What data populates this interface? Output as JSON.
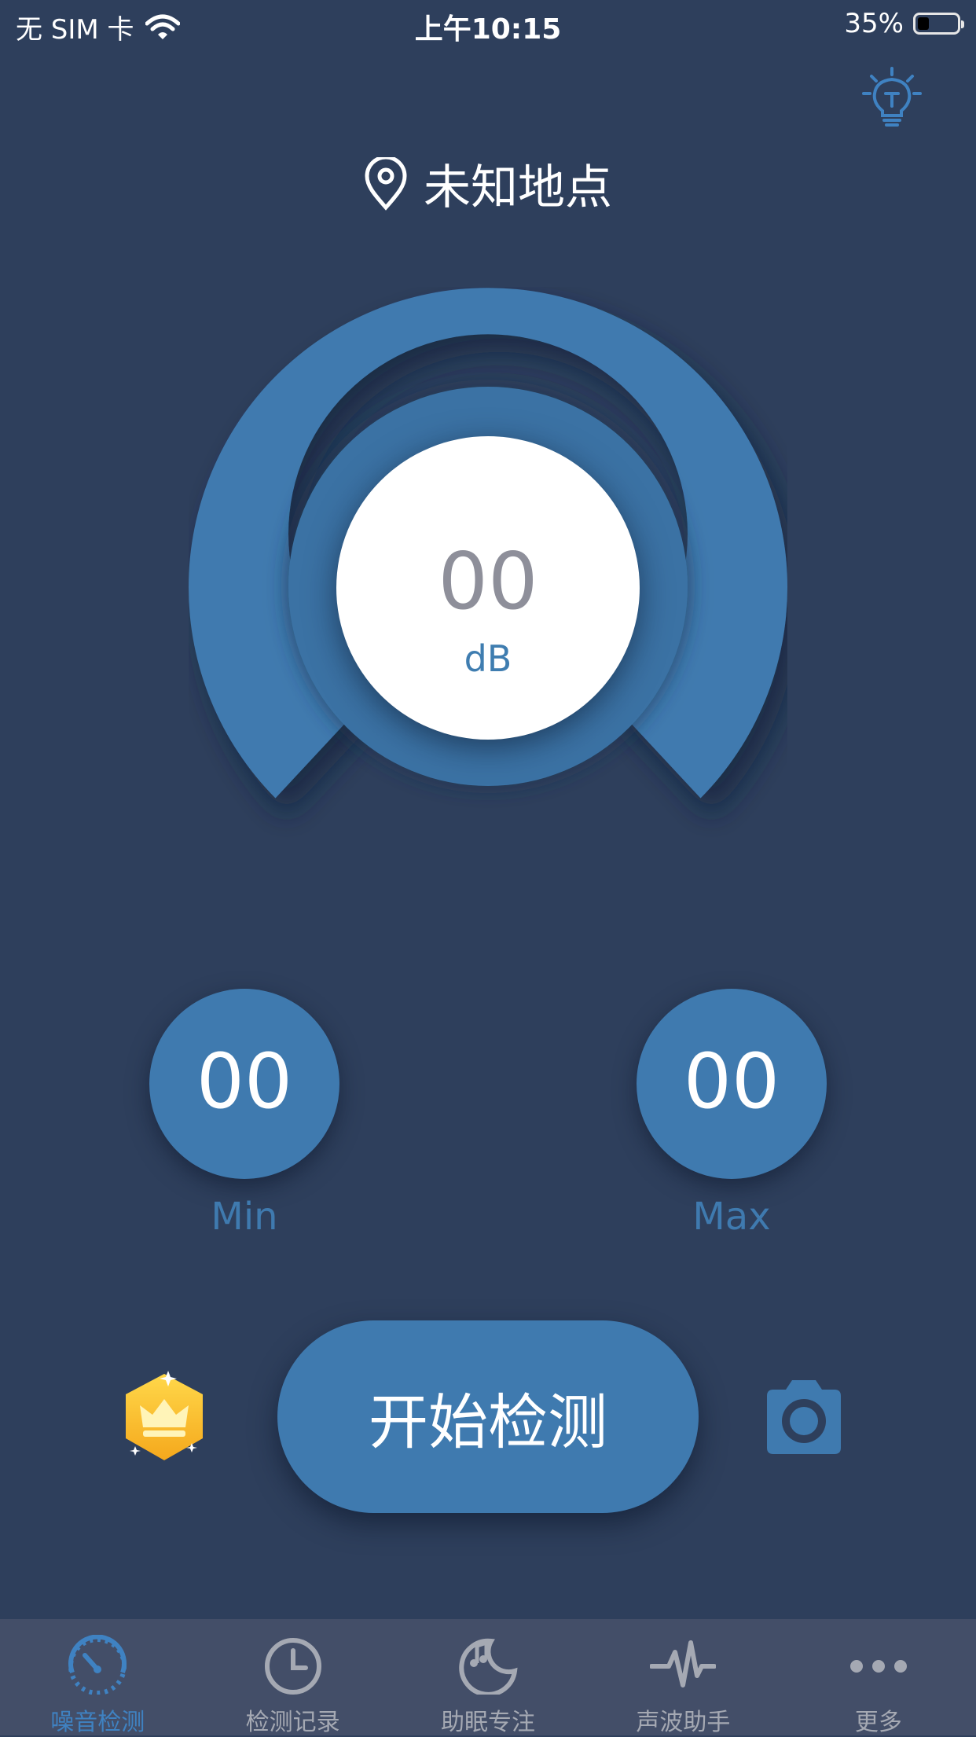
{
  "status_bar": {
    "carrier": "无 SIM 卡",
    "time": "上午10:15",
    "battery": "35%"
  },
  "header": {
    "location": "未知地点",
    "tip_icon": "lightbulb-icon"
  },
  "gauge": {
    "value": "00",
    "unit": "dB"
  },
  "stats": {
    "min_value": "00",
    "min_label": "Min",
    "max_value": "00",
    "max_label": "Max"
  },
  "actions": {
    "start_label": "开始检测",
    "vip_icon": "crown-badge-icon",
    "camera_icon": "camera-icon"
  },
  "tabs": [
    {
      "label": "噪音检测",
      "icon": "speedometer-icon",
      "active": true
    },
    {
      "label": "检测记录",
      "icon": "clock-icon",
      "active": false
    },
    {
      "label": "助眠专注",
      "icon": "moon-music-icon",
      "active": false
    },
    {
      "label": "声波助手",
      "icon": "waveform-icon",
      "active": false
    },
    {
      "label": "更多",
      "icon": "more-dots-icon",
      "active": false
    }
  ],
  "colors": {
    "background": "#2e3f5c",
    "accent": "#3f7aaf",
    "tab_bar": "#434e68",
    "tab_active": "#3f82c2",
    "tab_inactive": "#a5a9b3"
  }
}
